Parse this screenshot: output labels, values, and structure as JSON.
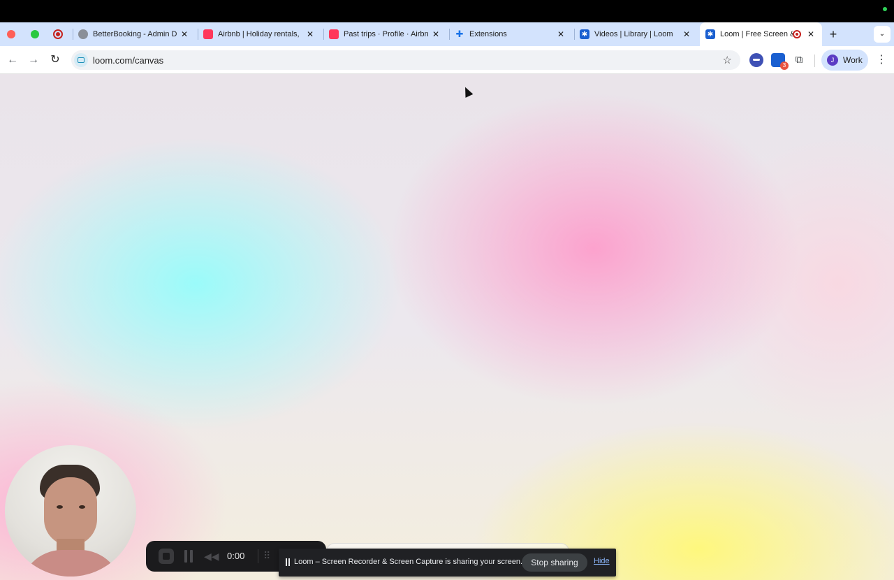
{
  "browser": {
    "tabs": [
      {
        "title": "BetterBooking - Admin D",
        "favicon": "globe-icon"
      },
      {
        "title": "Airbnb | Holiday rentals,",
        "favicon": "airbnb-icon"
      },
      {
        "title": "Past trips · Profile · Airbn",
        "favicon": "airbnb-icon"
      },
      {
        "title": "Extensions",
        "favicon": "puzzle-icon"
      },
      {
        "title": "Videos | Library | Loom",
        "favicon": "loom-icon"
      },
      {
        "title": "Loom | Free Screen &",
        "favicon": "loom-icon",
        "active": true,
        "recording": true
      }
    ],
    "address": "loom.com/canvas",
    "profile": {
      "initial": "J",
      "label": "Work"
    },
    "extension_badge": "3"
  },
  "loom_controls": {
    "timer": "0:00"
  },
  "share_notice": {
    "message": "Loom – Screen Recorder & Screen Capture is sharing your screen.",
    "stop_label": "Stop sharing",
    "hide_label": "Hide"
  },
  "colors": {
    "tab_strip": "#d3e3fd",
    "recording": "#c5221f",
    "share_bar": "#202124",
    "link": "#8ab4f8"
  }
}
